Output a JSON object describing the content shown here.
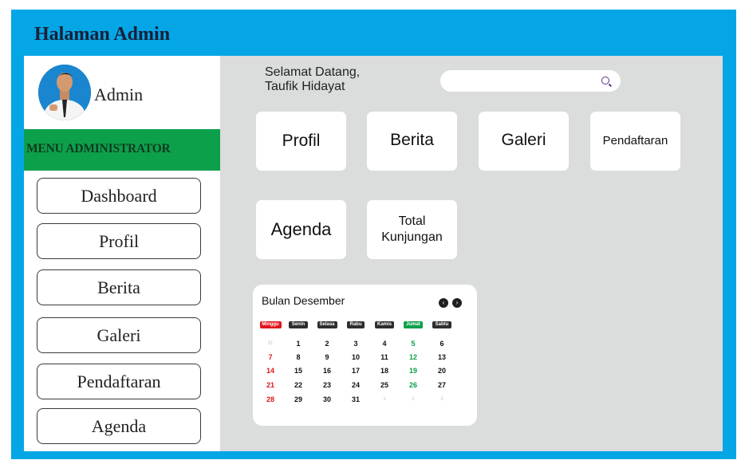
{
  "page_title": "Halaman Admin",
  "colors": {
    "frame": "#04a6e6",
    "menu_header": "#0da04b",
    "sunday": "#e0161b",
    "friday": "#0da04b",
    "content_bg": "#dbdcdc"
  },
  "sidebar": {
    "user_name": "Admin",
    "menu_header": "MENU ADMINISTRATOR",
    "items": [
      {
        "label": "Dashboard"
      },
      {
        "label": "Profil"
      },
      {
        "label": "Berita"
      },
      {
        "label": "Galeri"
      },
      {
        "label": "Pendaftaran"
      },
      {
        "label": "Agenda"
      }
    ]
  },
  "main": {
    "welcome_line1": "Selamat Datang,",
    "welcome_line2": "Taufik Hidayat",
    "search": {
      "placeholder": "",
      "icon": "search-icon"
    },
    "cards": [
      {
        "label": "Profil"
      },
      {
        "label": "Berita"
      },
      {
        "label": "Galeri"
      },
      {
        "label": "Pendaftaran"
      },
      {
        "label": "Agenda"
      },
      {
        "label": "Total Kunjungan"
      }
    ]
  },
  "calendar": {
    "title": "Bulan Desember",
    "prev_icon": "chevron-left-icon",
    "next_icon": "chevron-right-icon",
    "days": [
      "Minggu",
      "Senin",
      "Selasa",
      "Rabu",
      "Kamis",
      "Jumat",
      "Sabtu"
    ],
    "weeks": [
      [
        "31",
        "1",
        "2",
        "3",
        "4",
        "5",
        "6"
      ],
      [
        "7",
        "8",
        "9",
        "10",
        "11",
        "12",
        "13"
      ],
      [
        "14",
        "15",
        "16",
        "17",
        "18",
        "19",
        "20"
      ],
      [
        "21",
        "22",
        "23",
        "24",
        "25",
        "26",
        "27"
      ],
      [
        "28",
        "29",
        "30",
        "31",
        "1",
        "2",
        "3"
      ]
    ]
  }
}
